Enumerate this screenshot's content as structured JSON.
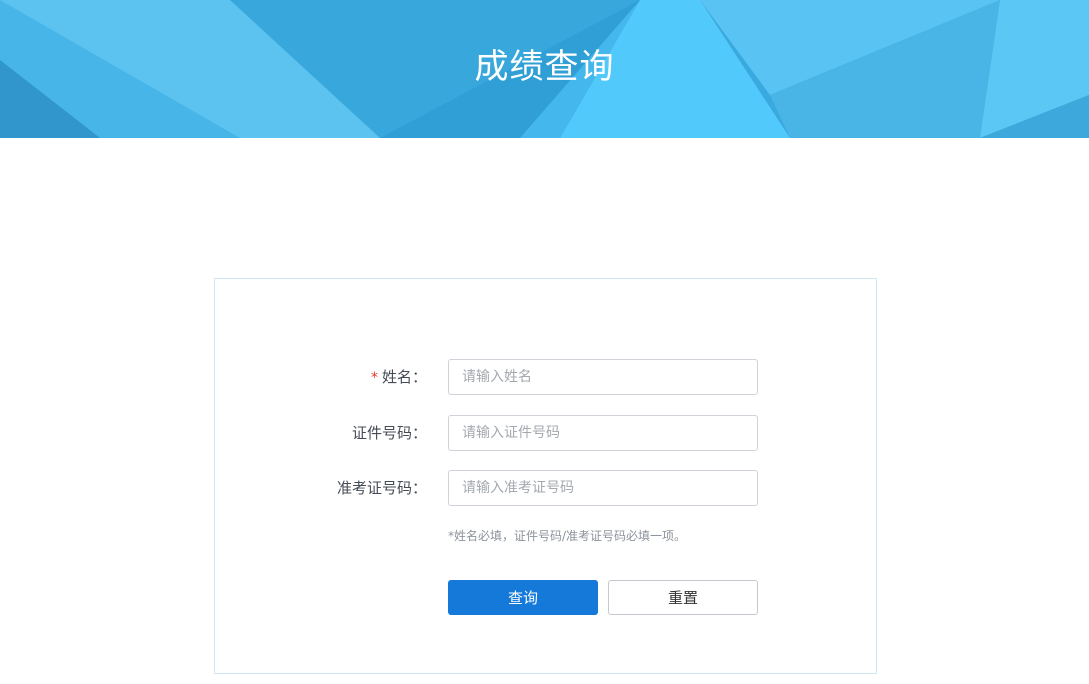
{
  "header": {
    "title": "成绩查询"
  },
  "form": {
    "fields": [
      {
        "label": "姓名：",
        "required": true,
        "required_mark": "*",
        "placeholder": "请输入姓名",
        "value": ""
      },
      {
        "label": "证件号码：",
        "required": false,
        "placeholder": "请输入证件号码",
        "value": ""
      },
      {
        "label": "准考证号码：",
        "required": false,
        "placeholder": "请输入准考证号码",
        "value": ""
      }
    ],
    "hint": "*姓名必填，证件号码/准考证号码必填一项。",
    "submit_label": "查询",
    "reset_label": "重置"
  },
  "colors": {
    "banner_base": "#3aa9df",
    "banner_light": "#5fc8f5",
    "primary": "#1479d9",
    "required": "#e8382c",
    "card_border": "#cfe6f5"
  }
}
